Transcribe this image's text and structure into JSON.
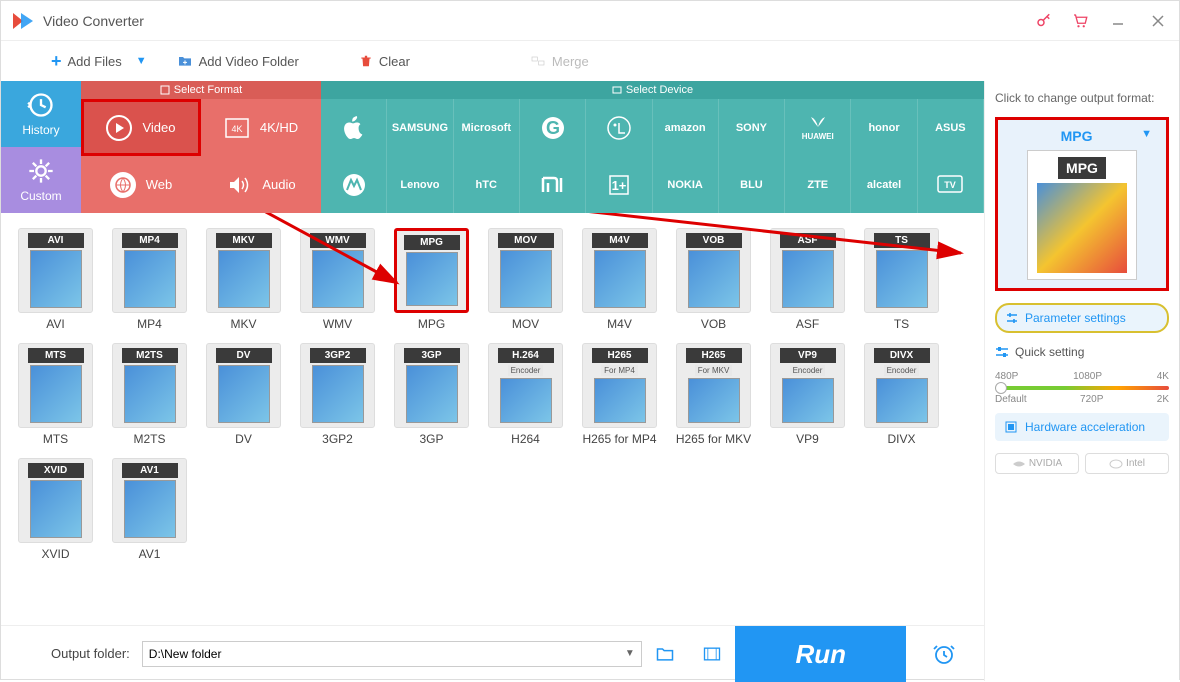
{
  "app": {
    "title": "Video Converter"
  },
  "toolbar": {
    "add_files": "Add Files",
    "add_folder": "Add Video Folder",
    "clear": "Clear",
    "merge": "Merge"
  },
  "left_tabs": {
    "history": "History",
    "custom": "Custom"
  },
  "format_header": "Select Format",
  "device_header": "Select Device",
  "format_cells": {
    "video": "Video",
    "fourk": "4K/HD",
    "web": "Web",
    "audio": "Audio"
  },
  "brands_row1": [
    "Apple",
    "SAMSUNG",
    "Microsoft",
    "G",
    "LG",
    "amazon",
    "SONY",
    "HUAWEI",
    "honor",
    "ASUS"
  ],
  "brands_row2": [
    "Moto",
    "Lenovo",
    "hTC",
    "mi",
    "OnePlus",
    "NOKIA",
    "BLU",
    "ZTE",
    "alcatel",
    "TV"
  ],
  "formats_row1": [
    "AVI",
    "MP4",
    "MKV",
    "WMV",
    "MPG",
    "MOV",
    "M4V",
    "VOB",
    "ASF",
    "TS"
  ],
  "formats_row2": [
    "MTS",
    "M2TS",
    "DV",
    "3GP2",
    "3GP",
    "H264",
    "H265 for MP4",
    "H265 for MKV",
    "VP9",
    "DIVX"
  ],
  "formats_row3": [
    "XVID",
    "AV1"
  ],
  "thumb_tags_row1": [
    "AVI",
    "MP4",
    "MKV",
    "WMV",
    "MPG",
    "MOV",
    "M4V",
    "VOB",
    "ASF",
    "TS"
  ],
  "thumb_tags_row2": [
    "MTS",
    "M2TS",
    "DV",
    "3GP2",
    "3GP",
    "H.264",
    "H265",
    "H265",
    "VP9",
    "DIVX"
  ],
  "thumb_tags_row3": [
    "XVID",
    "AV1"
  ],
  "thumb_sub_row2": [
    "",
    "",
    "",
    "",
    "",
    "Encoder",
    "For MP4",
    "For MKV",
    "Encoder",
    "Encoder"
  ],
  "sidebar": {
    "hint": "Click to change output format:",
    "selected_format": "MPG",
    "param_settings": "Parameter settings",
    "quick_setting": "Quick setting",
    "slider_top": [
      "480P",
      "1080P",
      "4K"
    ],
    "slider_bottom": [
      "Default",
      "720P",
      "2K"
    ],
    "hw_accel": "Hardware acceleration",
    "nvidia": "NVIDIA",
    "intel": "Intel"
  },
  "bottom": {
    "label": "Output folder:",
    "value": "D:\\New folder",
    "run": "Run"
  }
}
